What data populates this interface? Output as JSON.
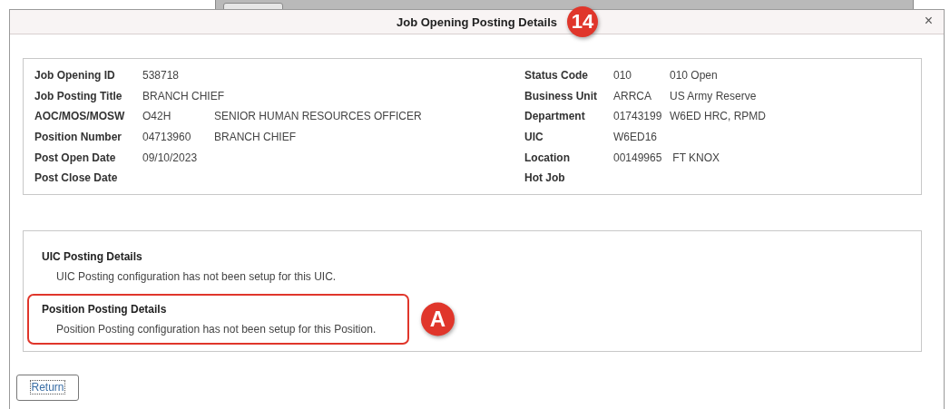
{
  "dialog": {
    "title": "Job Opening Posting Details",
    "step_badge": "14",
    "close": "×"
  },
  "details": {
    "left": [
      {
        "label": "Job Opening ID",
        "value": "538718"
      },
      {
        "label": "Job Posting Title",
        "value": "BRANCH CHIEF"
      },
      {
        "label": "AOC/MOS/MOSW",
        "value": "O42H",
        "description": "SENIOR HUMAN RESOURCES OFFICER"
      },
      {
        "label": "Position Number",
        "value": "04713960",
        "description": "BRANCH CHIEF"
      },
      {
        "label": "Post Open Date",
        "value": "09/10/2023"
      },
      {
        "label": "Post Close Date"
      }
    ],
    "right": [
      {
        "label": "Status Code",
        "value": "010",
        "description": "010 Open"
      },
      {
        "label": "Business Unit",
        "value": "ARRCA",
        "description": "US Army Reserve"
      },
      {
        "label": "Department",
        "value": "01743199",
        "description": "W6ED HRC, RPMD"
      },
      {
        "label": "UIC",
        "value": "W6ED16"
      },
      {
        "label": "Location",
        "value": "00149965",
        "description": " FT KNOX"
      },
      {
        "label": "Hot Job"
      }
    ]
  },
  "posting_sections": [
    {
      "heading": "UIC Posting Details",
      "message": "UIC Posting configuration has not been setup for this UIC.",
      "highlighted": false
    },
    {
      "heading": "Position Posting Details",
      "message": "Position Posting configuration has not been setup for this Position.",
      "highlighted": true,
      "callout": "A"
    }
  ],
  "buttons": [
    {
      "label": "Return",
      "focused": true
    }
  ]
}
